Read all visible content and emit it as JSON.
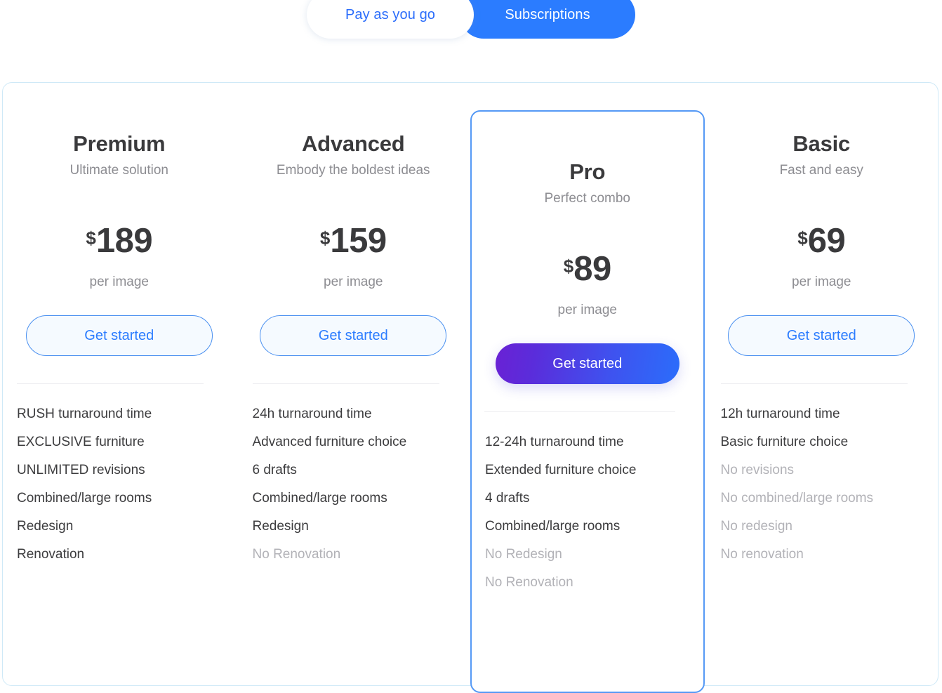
{
  "toggle": {
    "inactive_label": "Pay as you go",
    "active_label": "Subscriptions",
    "active_color": "#2b7cff",
    "inactive_text_color": "#2b6dfb"
  },
  "plans": [
    {
      "name": "Premium",
      "tagline": "Ultimate solution",
      "currency": "$",
      "price": "189",
      "price_note": "per image",
      "cta": "Get started",
      "featured": false,
      "features": [
        {
          "text": "RUSH turnaround time",
          "included": true
        },
        {
          "text": "EXCLUSIVE furniture",
          "included": true
        },
        {
          "text": "UNLIMITED revisions",
          "included": true
        },
        {
          "text": "Combined/large rooms",
          "included": true
        },
        {
          "text": "Redesign",
          "included": true
        },
        {
          "text": "Renovation",
          "included": true
        }
      ]
    },
    {
      "name": "Advanced",
      "tagline": "Embody the boldest ideas",
      "currency": "$",
      "price": "159",
      "price_note": "per image",
      "cta": "Get started",
      "featured": false,
      "features": [
        {
          "text": "24h turnaround time",
          "included": true
        },
        {
          "text": "Advanced furniture choice",
          "included": true
        },
        {
          "text": "6 drafts",
          "included": true
        },
        {
          "text": "Combined/large rooms",
          "included": true
        },
        {
          "text": "Redesign",
          "included": true
        },
        {
          "text": "No Renovation",
          "included": false
        }
      ]
    },
    {
      "name": "Pro",
      "tagline": "Perfect combo",
      "currency": "$",
      "price": "89",
      "price_note": "per image",
      "cta": "Get started",
      "featured": true,
      "features": [
        {
          "text": "12-24h turnaround time",
          "included": true
        },
        {
          "text": "Extended furniture choice",
          "included": true
        },
        {
          "text": "4 drafts",
          "included": true
        },
        {
          "text": "Combined/large rooms",
          "included": true
        },
        {
          "text": "No Redesign",
          "included": false
        },
        {
          "text": "No Renovation",
          "included": false
        }
      ]
    },
    {
      "name": "Basic",
      "tagline": "Fast and easy",
      "currency": "$",
      "price": "69",
      "price_note": "per image",
      "cta": "Get started",
      "featured": false,
      "features": [
        {
          "text": "12h turnaround time",
          "included": true
        },
        {
          "text": "Basic furniture choice",
          "included": true
        },
        {
          "text": "No revisions",
          "included": false
        },
        {
          "text": "No combined/large rooms",
          "included": false
        },
        {
          "text": "No redesign",
          "included": false
        },
        {
          "text": "No renovation",
          "included": false
        }
      ]
    }
  ],
  "colors": {
    "accent_blue": "#2b7cff",
    "featured_border": "#5599f5",
    "panel_border": "#cfe9f7",
    "text_dark": "#3a3a3c",
    "text_muted": "#8d8d92",
    "text_disabled": "#b2b2b7",
    "gradient_start": "#6a21d4",
    "gradient_end": "#2b6dfb"
  }
}
